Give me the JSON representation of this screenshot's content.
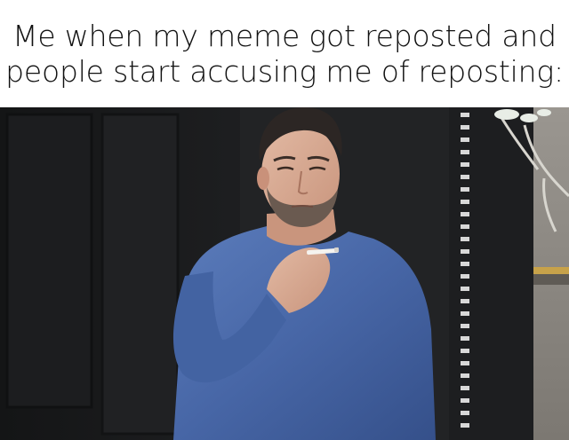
{
  "caption": {
    "line1": "Me when my meme got reposted and",
    "line2": "people start accusing me of reposting:"
  },
  "photo": {
    "subject": "man-in-blue-sweater-smoking",
    "sweater_color": "#4a6aa8",
    "background_color": "#1b1c1e"
  }
}
